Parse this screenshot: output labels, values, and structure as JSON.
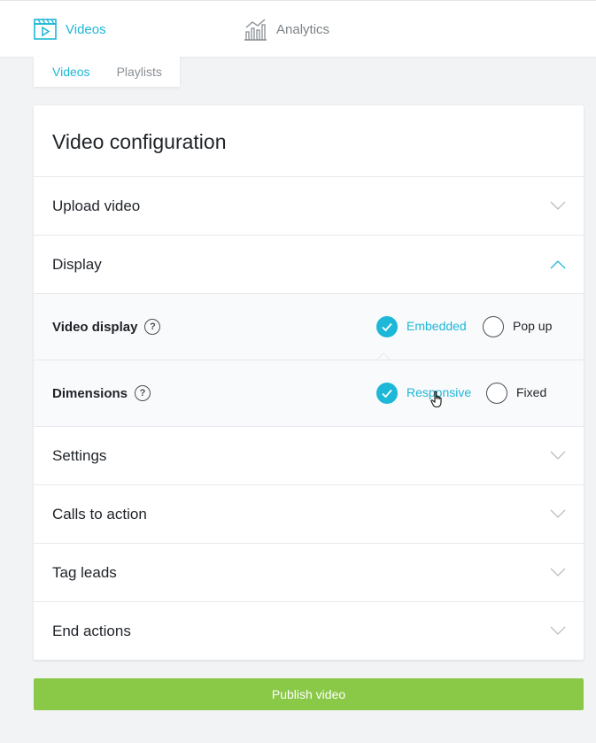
{
  "colors": {
    "accent": "#1db7d8",
    "publish": "#8ac847",
    "text": "#1f2328",
    "muted": "#7d8287"
  },
  "topnav": {
    "videos": {
      "label": "Videos",
      "icon": "video-clapper-icon"
    },
    "analytics": {
      "label": "Analytics",
      "icon": "bar-chart-icon"
    }
  },
  "subtabs": {
    "active": "Videos",
    "inactive": "Playlists"
  },
  "card": {
    "title": "Video configuration",
    "sections": {
      "upload": "Upload video",
      "display": "Display",
      "settings": "Settings",
      "calls": "Calls to action",
      "tags": "Tag leads",
      "end": "End actions"
    },
    "video_display": {
      "label": "Video display",
      "option_selected": "Embedded",
      "option_other": "Pop up"
    },
    "dimensions": {
      "label": "Dimensions",
      "option_selected": "Responsive",
      "option_other": "Fixed"
    }
  },
  "publish_label": "Publish video"
}
